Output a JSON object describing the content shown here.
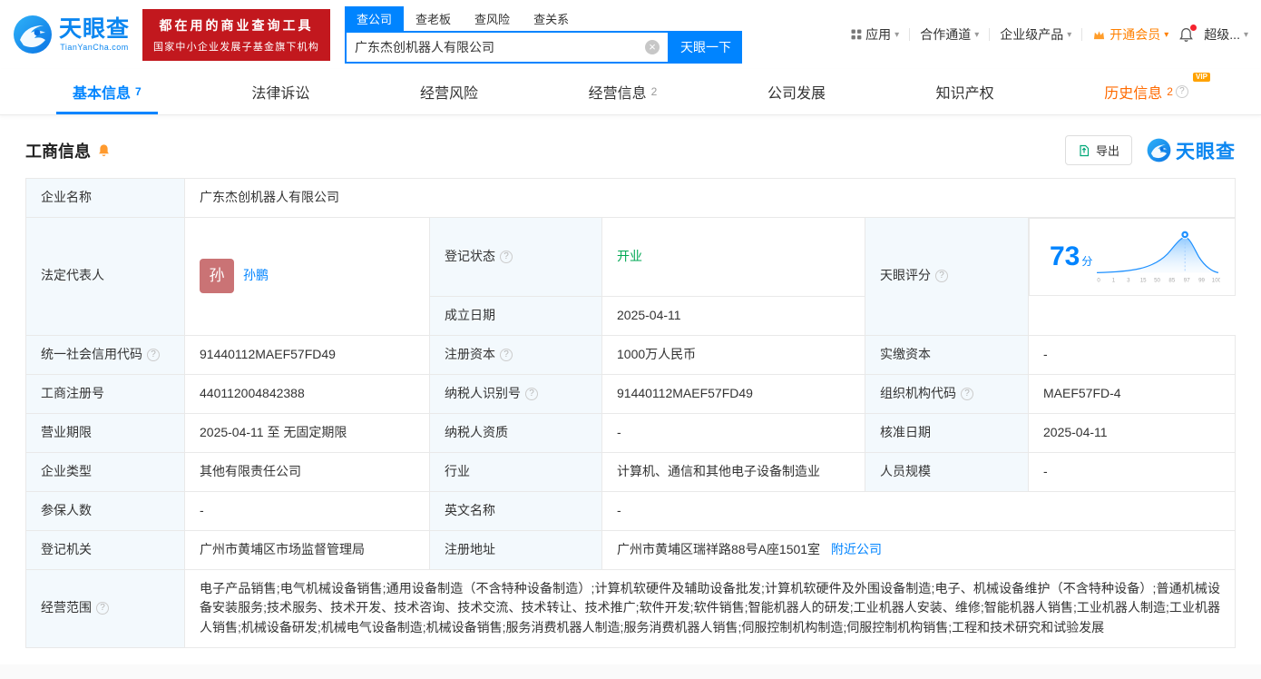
{
  "icons": {
    "help": "?",
    "chevron": "▾",
    "clear": "×"
  },
  "header": {
    "logo": {
      "name": "天眼查",
      "domain": "TianYanCha.com"
    },
    "promo": {
      "line1": "都在用的商业查询工具",
      "line2": "国家中小企业发展子基金旗下机构"
    },
    "search": {
      "tabs": [
        {
          "label": "查公司"
        },
        {
          "label": "查老板"
        },
        {
          "label": "查风险"
        },
        {
          "label": "查关系"
        }
      ],
      "value": "广东杰创机器人有限公司",
      "button": "天眼一下"
    },
    "nav": {
      "apps": "应用",
      "partners": "合作通道",
      "enterprise": "企业级产品",
      "membership": "开通会员",
      "super": "超级..."
    }
  },
  "main_tabs": [
    {
      "label": "基本信息",
      "count": "7"
    },
    {
      "label": "法律诉讼",
      "count": ""
    },
    {
      "label": "经营风险",
      "count": ""
    },
    {
      "label": "经营信息",
      "count": "2"
    },
    {
      "label": "公司发展",
      "count": ""
    },
    {
      "label": "知识产权",
      "count": ""
    },
    {
      "label": "历史信息",
      "count": "2",
      "badge": "VIP"
    }
  ],
  "section": {
    "title": "工商信息",
    "export": "导出",
    "brand": "天眼查"
  },
  "info": {
    "company_name": {
      "label": "企业名称",
      "value": "广东杰创机器人有限公司"
    },
    "legal_rep": {
      "label": "法定代表人",
      "avatar": "孙",
      "name": "孙鹏"
    },
    "reg_status": {
      "label": "登记状态",
      "value": "开业"
    },
    "established": {
      "label": "成立日期",
      "value": "2025-04-11"
    },
    "score": {
      "label": "天眼评分",
      "value": "73",
      "unit": "分"
    },
    "credit_code": {
      "label": "统一社会信用代码",
      "value": "91440112MAEF57FD49"
    },
    "reg_capital": {
      "label": "注册资本",
      "value": "1000万人民币"
    },
    "paid_capital": {
      "label": "实缴资本",
      "value": "-"
    },
    "reg_number": {
      "label": "工商注册号",
      "value": "440112004842388"
    },
    "taxpayer_id": {
      "label": "纳税人识别号",
      "value": "91440112MAEF57FD49"
    },
    "org_code": {
      "label": "组织机构代码",
      "value": "MAEF57FD-4"
    },
    "term": {
      "label": "营业期限",
      "value": "2025-04-11 至 无固定期限"
    },
    "taxpayer_qualification": {
      "label": "纳税人资质",
      "value": "-"
    },
    "approval_date": {
      "label": "核准日期",
      "value": "2025-04-11"
    },
    "company_type": {
      "label": "企业类型",
      "value": "其他有限责任公司"
    },
    "industry": {
      "label": "行业",
      "value": "计算机、通信和其他电子设备制造业"
    },
    "staff_size": {
      "label": "人员规模",
      "value": "-"
    },
    "insured_count": {
      "label": "参保人数",
      "value": "-"
    },
    "english_name": {
      "label": "英文名称",
      "value": "-"
    },
    "reg_authority": {
      "label": "登记机关",
      "value": "广州市黄埔区市场监督管理局"
    },
    "reg_address": {
      "label": "注册地址",
      "value": "广州市黄埔区瑞祥路88号A座1501室",
      "nearby": "附近公司"
    },
    "business_scope": {
      "label": "经营范围",
      "value": "电子产品销售;电气机械设备销售;通用设备制造（不含特种设备制造）;计算机软硬件及辅助设备批发;计算机软硬件及外围设备制造;电子、机械设备维护（不含特种设备）;普通机械设备安装服务;技术服务、技术开发、技术咨询、技术交流、技术转让、技术推广;软件开发;软件销售;智能机器人的研发;工业机器人安装、维修;智能机器人销售;工业机器人制造;工业机器人销售;机械设备研发;机械电气设备制造;机械设备销售;服务消费机器人制造;服务消费机器人销售;伺服控制机构制造;伺服控制机构销售;工程和技术研究和试验发展"
    }
  },
  "score_chart": {
    "type": "area",
    "score": 73,
    "x_ticks": [
      "0",
      "1",
      "3",
      "15",
      "50",
      "85",
      "97",
      "99",
      "100"
    ]
  }
}
